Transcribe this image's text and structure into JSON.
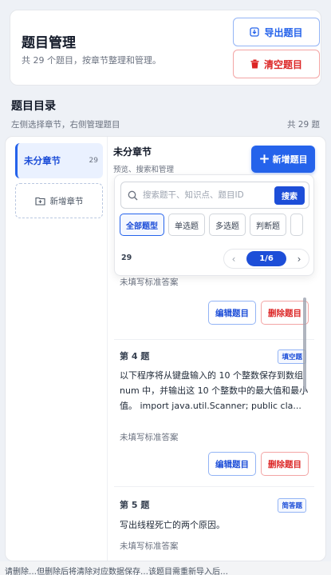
{
  "header": {
    "title": "题目管理",
    "subtitle": "共 29 个题目，按章节整理和管理。",
    "export_label": "导出题目",
    "clear_label": "清空题目"
  },
  "section": {
    "title": "题目目录",
    "subtitle": "左侧选择章节，右侧管理题目",
    "count": "共 29 题"
  },
  "sidebar": {
    "chapters": [
      {
        "name": "未分章节",
        "count": "29"
      }
    ],
    "add_label": "新增章节"
  },
  "main": {
    "chapter_title": "未分章节",
    "chapter_hint": "预览、搜索和管理",
    "add_question_label": "新增题目",
    "search_placeholder": "搜索题干、知识点、题目ID",
    "search_label": "搜索",
    "types": [
      "全部题型",
      "单选题",
      "多选题",
      "判断题"
    ],
    "total": "29",
    "page": "1/6"
  },
  "questions": [
    {
      "answer_text": "未填写标准答案",
      "edit_label": "编辑题目",
      "delete_label": "删除题目"
    },
    {
      "number": "第 4 题",
      "type": "填空题",
      "text": "以下程序将从键盘输入的 10 个整数保存到数组 num 中，并输出这 10 个整数中的最大值和最小值。 import java.util.Scanner; public cla...",
      "answer_text": "未填写标准答案",
      "edit_label": "编辑题目",
      "delete_label": "删除题目"
    },
    {
      "number": "第 5 题",
      "type": "简答题",
      "text": "写出线程死亡的两个原因。",
      "answer_text": "未填写标准答案"
    }
  ],
  "footer_text": "请删除…但删除后将清除对应数据保存…该题目需重新导入后…"
}
